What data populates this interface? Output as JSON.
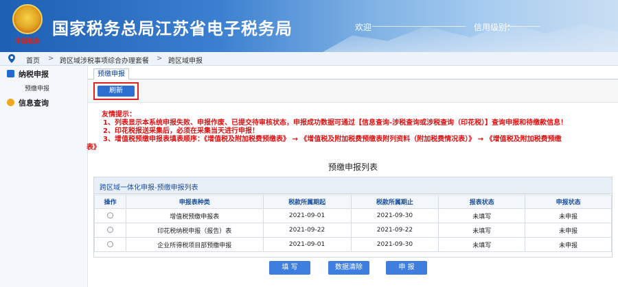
{
  "header": {
    "emblem_text": "中国税务",
    "title": "国家税务总局江苏省电子税务局",
    "welcome_label": "欢迎",
    "credit_label": "信用级别："
  },
  "breadcrumb": {
    "items": [
      "首页",
      "跨区域涉税事项综合办理套餐",
      "跨区域申报"
    ],
    "separator": ">"
  },
  "sidebar": {
    "sections": [
      {
        "label": "纳税申报",
        "icon": "grid-icon",
        "items": [
          "预缴申报"
        ]
      },
      {
        "label": "信息查询",
        "icon": "chat-bubble-icon",
        "items": []
      }
    ]
  },
  "tabs": [
    {
      "label": "预缴申报"
    }
  ],
  "toolbar": {
    "refresh_label": "刷新"
  },
  "tips": {
    "heading": "友情提示：",
    "lines": [
      "1、列表显示本系统申报失败、申报作废、已提交待审核状态，申报成功数据可通过【信息查询-涉税查询或涉税查询（印花税）】查询申报和待缴款信息！",
      "2、印花税报送采集后，必须在采集当天进行申报！",
      "3、增值税预缴申报表填表顺序：《增值税及附加税费预缴表》 → 《增值税及附加税费预缴表附列资料（附加税费情况表）》 → 《增值税及附加税费预缴"
    ],
    "tail": "表》"
  },
  "list_title": "预缴申报列表",
  "panel": {
    "title": "跨区域一体化申报-预缴申报列表",
    "columns": [
      "操作",
      "申报表种类",
      "税款所属期起",
      "税款所属期止",
      "报表状态",
      "申报状态"
    ],
    "rows": [
      {
        "type": "增值税预缴申报表",
        "start": "2021-09-01",
        "end": "2021-09-30",
        "report_status": "未填写",
        "filing_status": "未申报"
      },
      {
        "type": "印花税纳税申报（报告）表",
        "start": "2021-09-22",
        "end": "2021-09-22",
        "report_status": "未填写",
        "filing_status": "未申报"
      },
      {
        "type": "企业所得税项目部预缴申报",
        "start": "2021-09-01",
        "end": "2021-09-30",
        "report_status": "未填写",
        "filing_status": "未申报"
      }
    ]
  },
  "actions": {
    "fill_label": "填 写",
    "clear_label": "数据清除",
    "submit_label": "申 报"
  },
  "colors": {
    "accent": "#2c6fd1",
    "warning": "#e01010",
    "header_blue": "#1d5fb3"
  }
}
